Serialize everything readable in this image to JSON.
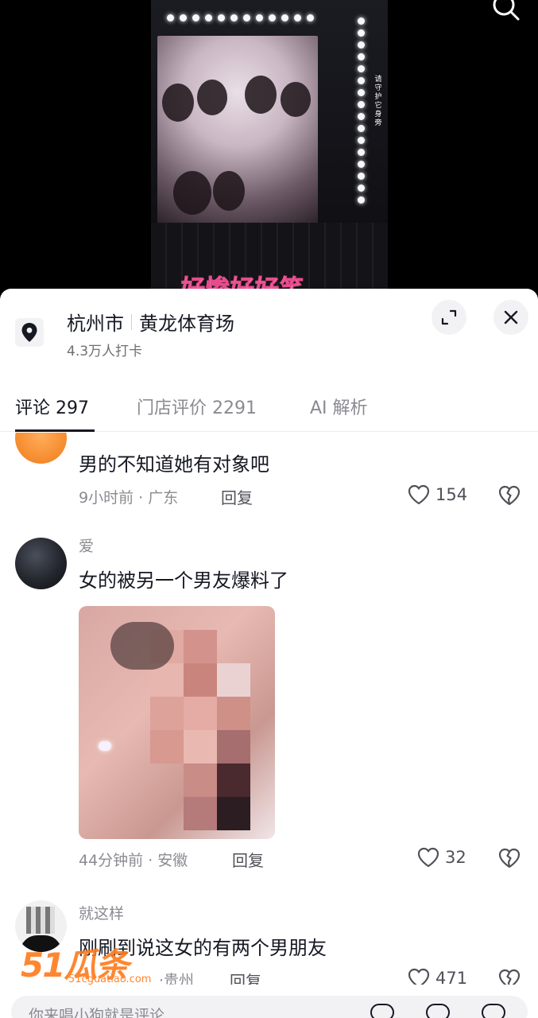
{
  "video": {
    "subtitle": "好惨好好笑",
    "side_text": "请守护它身旁"
  },
  "location": {
    "city": "杭州市",
    "place": "黄龙体育场",
    "checkins": "4.3万人打卡"
  },
  "tabs": [
    {
      "label": "评论 297",
      "active": true
    },
    {
      "label": "门店评价 2291",
      "active": false
    },
    {
      "label": "AI 解析",
      "active": false
    }
  ],
  "comments": [
    {
      "name": "",
      "text": "男的不知道她有对象吧",
      "time": "9小时前 · 广东",
      "reply": "回复",
      "likes": "154"
    },
    {
      "name": "爱",
      "text": "女的被另一个男友爆料了",
      "time": "44分钟前 · 安徽",
      "reply": "回复",
      "likes": "32"
    },
    {
      "name": "就这样",
      "text": "刚刷到说这女的有两个男朋友",
      "time": "·贵州",
      "reply": "回复",
      "likes": "471"
    }
  ],
  "watermark": {
    "logo": "51瓜条",
    "url": "51cguatiao.com"
  },
  "input": {
    "placeholder": "你来唱小狗就是评论"
  },
  "colors": {
    "accent_orange": "#ff7a1a",
    "text_primary": "#161823",
    "text_secondary": "#8a8b91"
  }
}
